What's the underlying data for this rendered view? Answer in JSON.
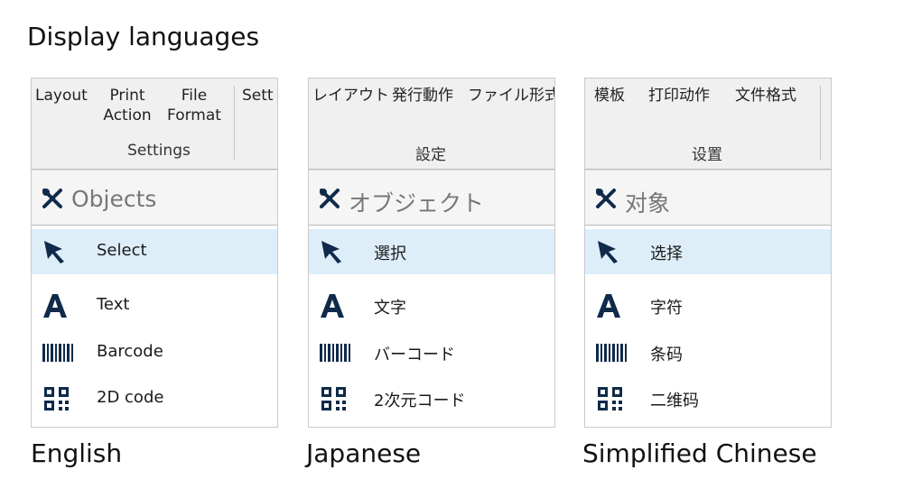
{
  "heading": "Display languages",
  "icons": {
    "objects": "tools-icon",
    "select": "cursor-arrow-icon",
    "text": "letter-a-icon",
    "barcode": "barcode-icon",
    "qr": "qr-code-icon"
  },
  "colors": {
    "icon": "#0f2a4a",
    "selected_bg": "#ddeef9",
    "ribbon_bg": "#f0f0f0"
  },
  "panels": [
    {
      "caption": "English",
      "ribbon": {
        "tabs": [
          "Layout",
          "Print Action",
          "File Format",
          "Sett"
        ],
        "group_label": "Settings"
      },
      "objects_header": "Objects",
      "items": [
        "Select",
        "Text",
        "Barcode",
        "2D code"
      ]
    },
    {
      "caption": "Japanese",
      "ribbon": {
        "tabs": [
          "レイアウト",
          "発行動作",
          "ファイル形式"
        ],
        "group_label": "設定"
      },
      "objects_header": "オブジェクト",
      "items": [
        "選択",
        "文字",
        "バーコード",
        "2次元コード"
      ]
    },
    {
      "caption": "Simplified Chinese",
      "ribbon": {
        "tabs": [
          "模板",
          "打印动作",
          "文件格式"
        ],
        "group_label": "设置"
      },
      "objects_header": "对象",
      "items": [
        "选择",
        "字符",
        "条码",
        "二维码"
      ]
    }
  ]
}
